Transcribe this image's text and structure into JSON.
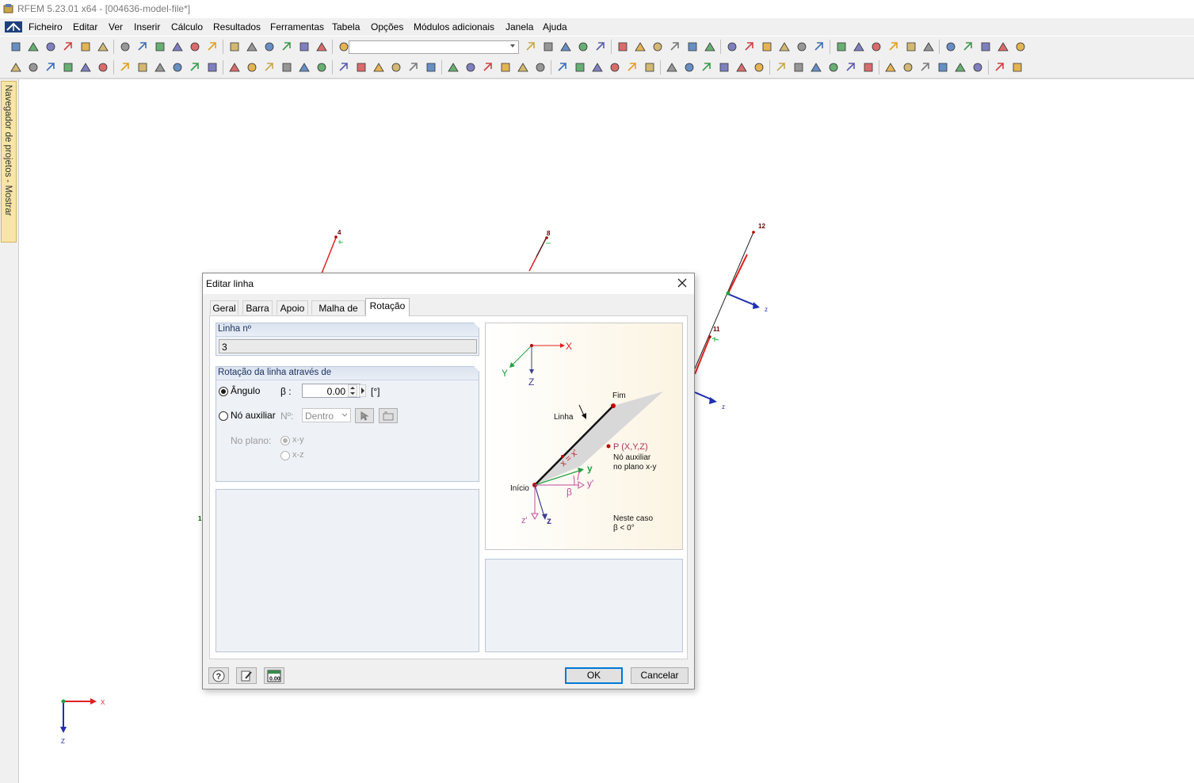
{
  "window": {
    "title": "RFEM 5.23.01 x64 - [004636-model-file*]"
  },
  "menu": [
    "Ficheiro",
    "Editar",
    "Ver",
    "Inserir",
    "Cálculo",
    "Resultados",
    "Ferramentas",
    "Tabela",
    "Opções",
    "Módulos adicionais",
    "Janela",
    "Ajuda"
  ],
  "navigator": {
    "label": "Navegador de projetos - Mostrar"
  },
  "model": {
    "node_labels": [
      "4",
      "8",
      "12",
      "11",
      "1"
    ],
    "axis_label_z": "z",
    "global_axes": {
      "x": "X",
      "z": "Z"
    }
  },
  "dialog": {
    "title": "Editar linha",
    "tabs": [
      "Geral",
      "Barra",
      "Apoio",
      "Malha de EF",
      "Rotação"
    ],
    "active_tab": "Rotação",
    "line_no": {
      "header": "Linha nº",
      "value": "3"
    },
    "rotation": {
      "header": "Rotação da linha através de",
      "angle_label": "Ângulo",
      "beta_label": "β :",
      "beta_value": "0.00",
      "unit": "[°]",
      "aux_node_label": "Nó auxiliar",
      "no_label": "Nº:",
      "position_value": "Dentro",
      "plane_label": "No plano:",
      "plane_options": [
        "x-y",
        "x-z"
      ],
      "selected": "angle"
    },
    "diagram": {
      "axis_x": "X",
      "axis_y": "Y",
      "axis_z": "Z",
      "fim": "Fim",
      "linha": "Linha",
      "inicio": "Início",
      "point": "P (X,Y,Z)",
      "aux_text_1": "Nó auxiliar",
      "aux_text_2": "no plano x-y",
      "x_label": "x = x'",
      "y_label": "y",
      "y_prime": "y'",
      "z_label": "z",
      "z_prime": "z'",
      "beta": "β",
      "case_1": "Neste caso",
      "case_2": "β < 0°"
    },
    "buttons": {
      "ok": "OK",
      "cancel": "Cancelar",
      "units_icon": "0.00"
    }
  },
  "colors": {
    "axis_red": "#e02020",
    "axis_blue": "#1f2fb0",
    "axis_green": "#22a042",
    "node_red": "#c00000",
    "support_green": "#3cbf5a"
  }
}
